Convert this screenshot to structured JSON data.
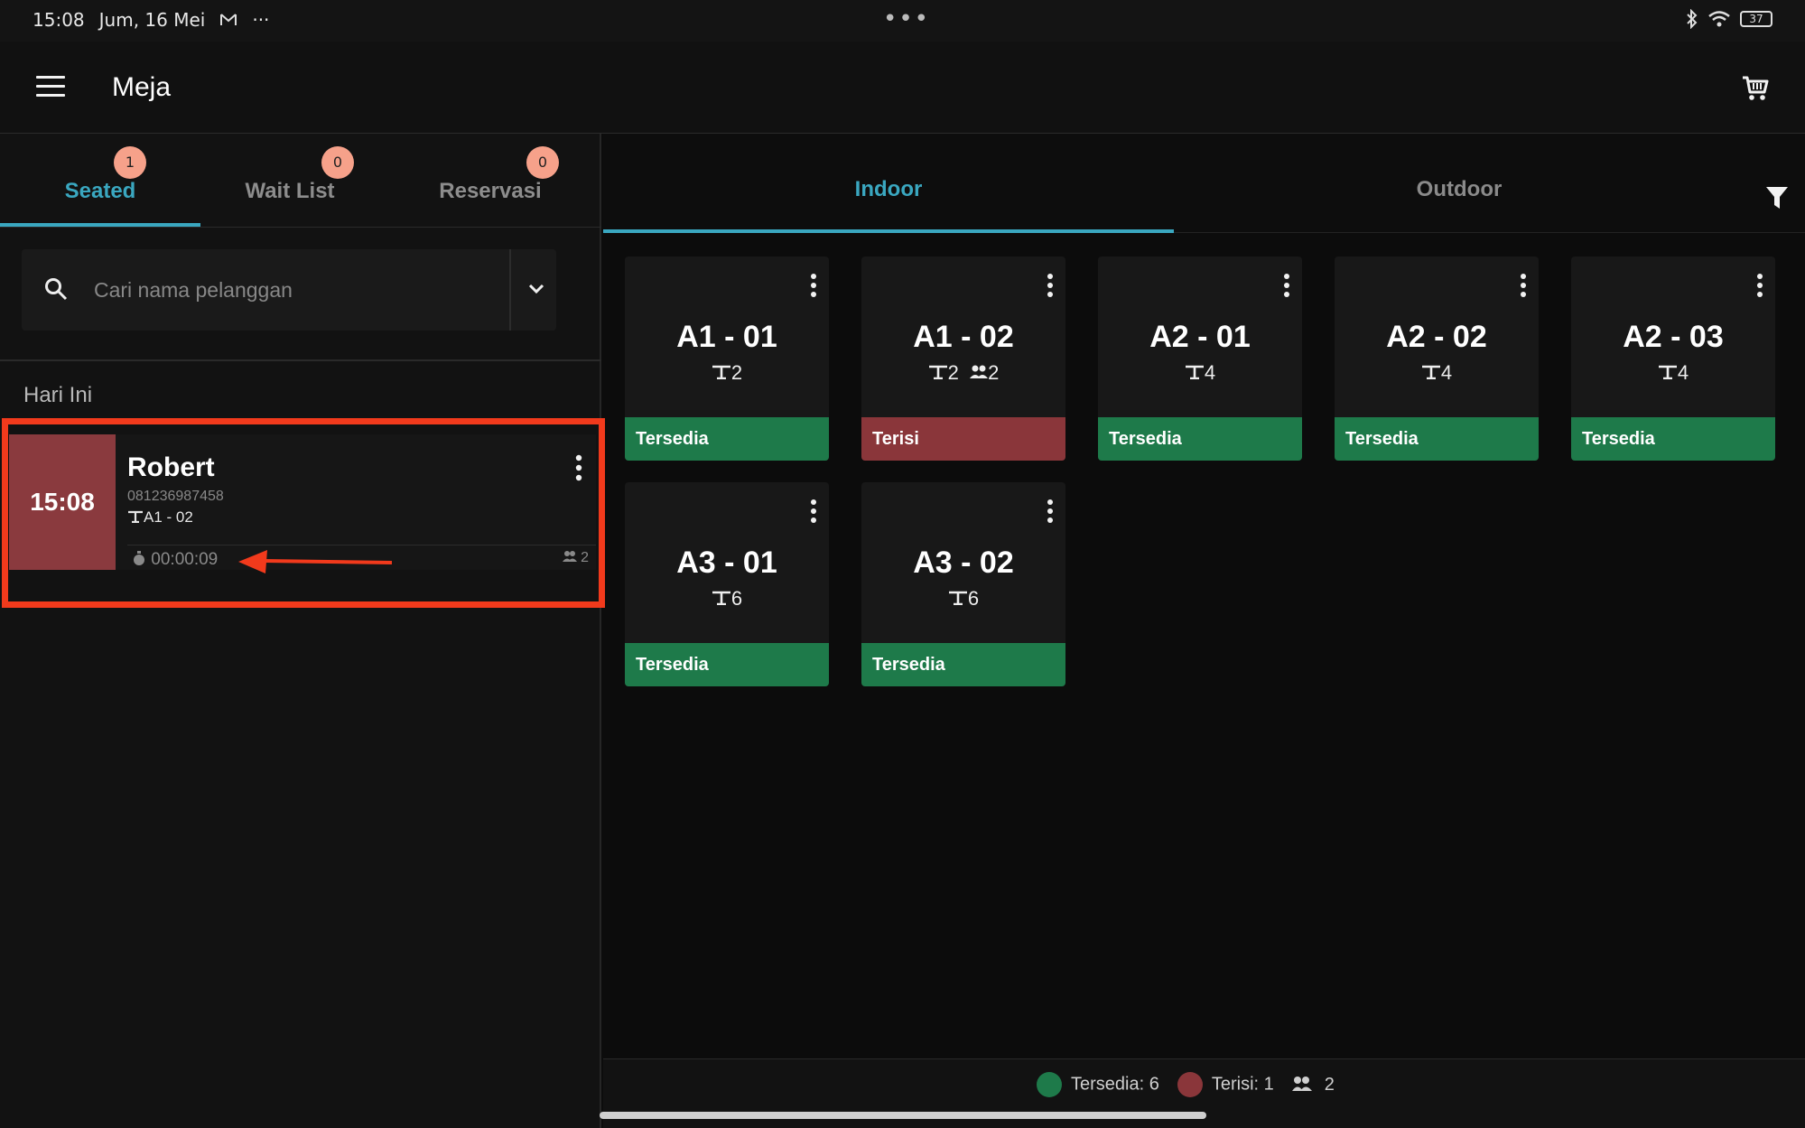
{
  "status_bar": {
    "time": "15:08",
    "date": "Jum, 16 Mei",
    "battery": "37",
    "center_dots": "•••"
  },
  "header": {
    "title": "Meja"
  },
  "left_tabs": [
    {
      "label": "Seated",
      "badge": "1"
    },
    {
      "label": "Wait List",
      "badge": "0"
    },
    {
      "label": "Reservasi",
      "badge": "0"
    }
  ],
  "search": {
    "placeholder": "Cari nama pelanggan"
  },
  "section": {
    "title": "Hari Ini"
  },
  "order": {
    "time": "15:08",
    "name": "Robert",
    "phone": "081236987458",
    "table": "A1 - 02",
    "timer": "00:00:09",
    "guests": "2"
  },
  "right_tabs": [
    {
      "label": "Indoor"
    },
    {
      "label": "Outdoor"
    }
  ],
  "tables": [
    {
      "name": "A1 - 01",
      "seats": "2",
      "guests": "",
      "status": "Tersedia"
    },
    {
      "name": "A1 - 02",
      "seats": "2",
      "guests": "2",
      "status": "Terisi"
    },
    {
      "name": "A2 - 01",
      "seats": "4",
      "guests": "",
      "status": "Tersedia"
    },
    {
      "name": "A2 - 02",
      "seats": "4",
      "guests": "",
      "status": "Tersedia"
    },
    {
      "name": "A2 - 03",
      "seats": "4",
      "guests": "",
      "status": "Tersedia"
    },
    {
      "name": "A3 - 01",
      "seats": "6",
      "guests": "",
      "status": "Tersedia"
    },
    {
      "name": "A3 - 02",
      "seats": "6",
      "guests": "",
      "status": "Tersedia"
    }
  ],
  "footer": {
    "available": "Tersedia: 6",
    "occupied": "Terisi: 1",
    "guests": "2"
  },
  "colors": {
    "accent": "#3aa7c0",
    "available": "#1e7a4a",
    "occupied": "#8a363a",
    "badge": "#f6a18a"
  }
}
